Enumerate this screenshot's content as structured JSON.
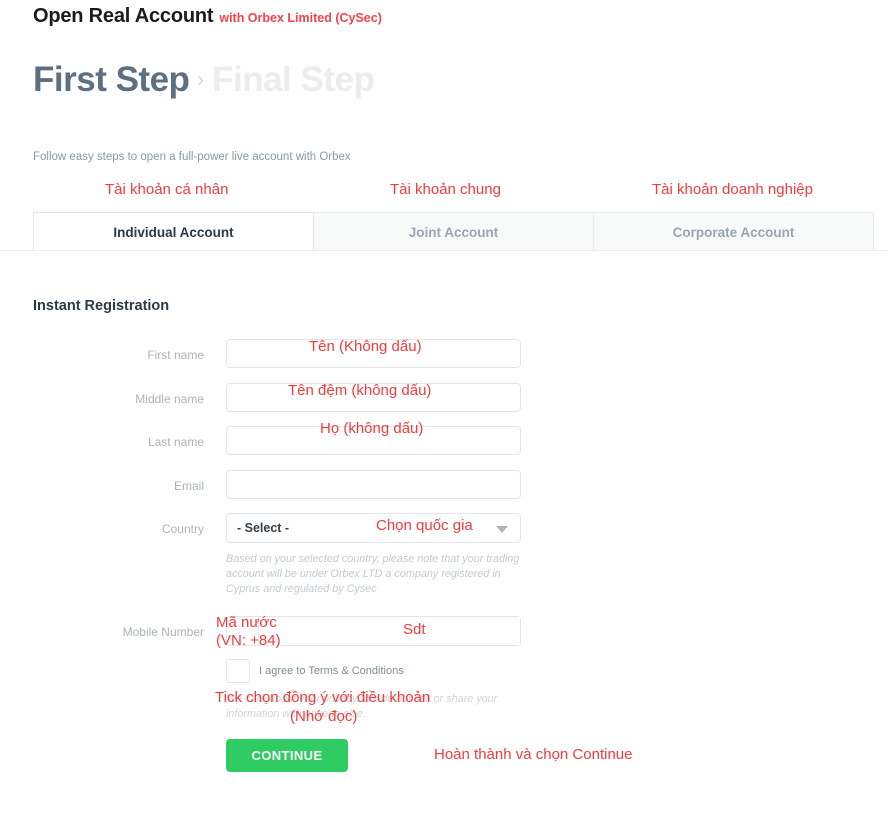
{
  "header": {
    "title": "Open Real Account",
    "subtitle": "with Orbex Limited (CySec)"
  },
  "steps": {
    "first": "First Step",
    "arrow": "›",
    "final": "Final Step"
  },
  "intro": "Follow easy steps to open a full-power live account with Orbex",
  "tabs": [
    {
      "label": "Individual Account",
      "active": true
    },
    {
      "label": "Joint Account",
      "active": false
    },
    {
      "label": "Corporate Account",
      "active": false
    }
  ],
  "form": {
    "section_title": "Instant Registration",
    "fields": [
      {
        "label": "First name",
        "value": "",
        "placeholder": ""
      },
      {
        "label": "Middle name",
        "value": "",
        "placeholder": ""
      },
      {
        "label": "Last name",
        "value": "",
        "placeholder": ""
      },
      {
        "label": "Email",
        "value": "",
        "placeholder": ""
      }
    ],
    "country": {
      "label": "Country",
      "selected": "- Select -",
      "helper": "Based on your selected country, please note that your trading account will be under Orbex LTD a company registered in Cyprus and regulated by Cysec"
    },
    "mobile": {
      "label": "Mobile Number",
      "country_code": "",
      "number": ""
    },
    "terms": {
      "checkbox_label": "I agree to Terms & Conditions",
      "checked": false
    },
    "privacy": "We care about your privacy. We do not sell or share your information with anyone else.",
    "continue_label": "CONTINUE"
  },
  "annotations": {
    "tab_individual": "Tài khoản cá nhân",
    "tab_joint": "Tài khoản chung",
    "tab_corporate": "Tài khoản doanh nghiệp",
    "first_name": "Tên (Không dấu)",
    "middle_name": "Tên đệm (không dấu)",
    "last_name": "Họ (không dấu)",
    "country": "Chọn quốc gia",
    "country_code_line1": "Mã nước",
    "country_code_line2": "(VN: +84)",
    "phone": "Sdt",
    "terms_line1": "Tick chọn đồng ý với điều khoản",
    "terms_line2": "(Nhớ đọc)",
    "continue": "Hoàn thành và chọn Continue"
  },
  "colors": {
    "brand_red": "#f0444a",
    "annotation_red": "#f23b3b",
    "step_active": "#5d7082",
    "step_inactive": "#ececec",
    "continue_green": "#2ecc63"
  }
}
